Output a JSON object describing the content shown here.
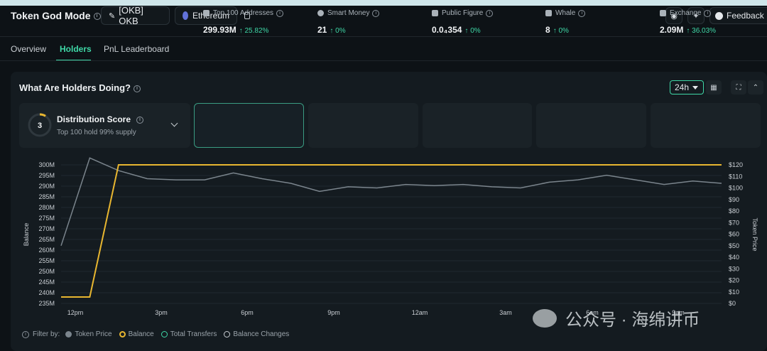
{
  "header": {
    "title": "Token God Mode",
    "token_chip": "[OKB] OKB",
    "chain_chip": "Ethereum",
    "feedback_label": "Feedback"
  },
  "tabs": [
    {
      "label": "Overview",
      "active": false
    },
    {
      "label": "Holders",
      "active": true
    },
    {
      "label": "PnL Leaderboard",
      "active": false
    }
  ],
  "panel": {
    "title": "What Are Holders Doing?",
    "time_range": "24h"
  },
  "distribution": {
    "score": "3",
    "label": "Distribution Score",
    "sub": "Top 100 hold 99% supply"
  },
  "cards": [
    {
      "label": "Top 100 Addresses",
      "value": "299.93M",
      "change": "↑ 25.82%",
      "selected": true,
      "icon": "wallet-icon"
    },
    {
      "label": "Smart Money",
      "value": "21",
      "change": "↑ 0%",
      "selected": false,
      "icon": "smart-money-icon"
    },
    {
      "label": "Public Figure",
      "value": "0.0₄354",
      "change": "↑ 0%",
      "selected": false,
      "icon": "public-figure-icon"
    },
    {
      "label": "Whale",
      "value": "8",
      "change": "↑ 0%",
      "selected": false,
      "icon": "whale-icon"
    },
    {
      "label": "Exchange",
      "value": "2.09M",
      "change": "↑ 36.03%",
      "selected": false,
      "icon": "exchange-icon"
    }
  ],
  "legend": {
    "prefix": "Filter by:",
    "items": [
      {
        "label": "Token Price",
        "color": "#7b858d",
        "filled": true
      },
      {
        "label": "Balance",
        "color": "#e8b630",
        "filled": true
      },
      {
        "label": "Total Transfers",
        "color": "#3fd8a7",
        "filled": false
      },
      {
        "label": "Balance Changes",
        "color": "#c9ced3",
        "filled": false
      }
    ]
  },
  "watermark": "公众号 · 海绵讲币",
  "colors": {
    "accent": "#3fd8a7",
    "balance": "#e8b630",
    "price": "#7b858d",
    "panel": "#141b20"
  },
  "chart_data": {
    "type": "line",
    "ylabel": "Balance",
    "y2label": "Token Price",
    "ylim": [
      235,
      300
    ],
    "y_ticks": [
      "300M",
      "295M",
      "290M",
      "285M",
      "280M",
      "275M",
      "270M",
      "265M",
      "260M",
      "255M",
      "250M",
      "245M",
      "240M",
      "235M"
    ],
    "y2lim": [
      0,
      120
    ],
    "y2_ticks": [
      "$120",
      "$110",
      "$100",
      "$90",
      "$80",
      "$70",
      "$60",
      "$50",
      "$40",
      "$30",
      "$20",
      "$10",
      "$0"
    ],
    "x_ticks": [
      "12pm",
      "3pm",
      "6pm",
      "9pm",
      "12am",
      "3am",
      "6am",
      "9am"
    ],
    "x_count": 24,
    "grid": true,
    "series": [
      {
        "name": "Balance",
        "axis": "left",
        "color": "#e8b630",
        "x": [
          0,
          1,
          2,
          3,
          4,
          5,
          6,
          7,
          8,
          9,
          10,
          11,
          12,
          13,
          14,
          15,
          16,
          17,
          18,
          19,
          20,
          21,
          22,
          23
        ],
        "values": [
          238,
          238,
          300,
          300,
          300,
          300,
          300,
          300,
          300,
          300,
          300,
          300,
          300,
          300,
          300,
          300,
          300,
          300,
          300,
          300,
          300,
          300,
          300,
          300
        ]
      },
      {
        "name": "Token Price",
        "axis": "right",
        "color": "#7b858d",
        "x": [
          0,
          1,
          2,
          3,
          4,
          5,
          6,
          7,
          8,
          9,
          10,
          11,
          12,
          13,
          14,
          15,
          16,
          17,
          18,
          19,
          20,
          21,
          22,
          23
        ],
        "values": [
          50,
          126,
          115,
          108,
          107,
          107,
          113,
          108,
          104,
          97,
          101,
          100,
          103,
          102,
          103,
          101,
          100,
          105,
          107,
          111,
          107,
          103,
          106,
          104
        ]
      }
    ]
  }
}
